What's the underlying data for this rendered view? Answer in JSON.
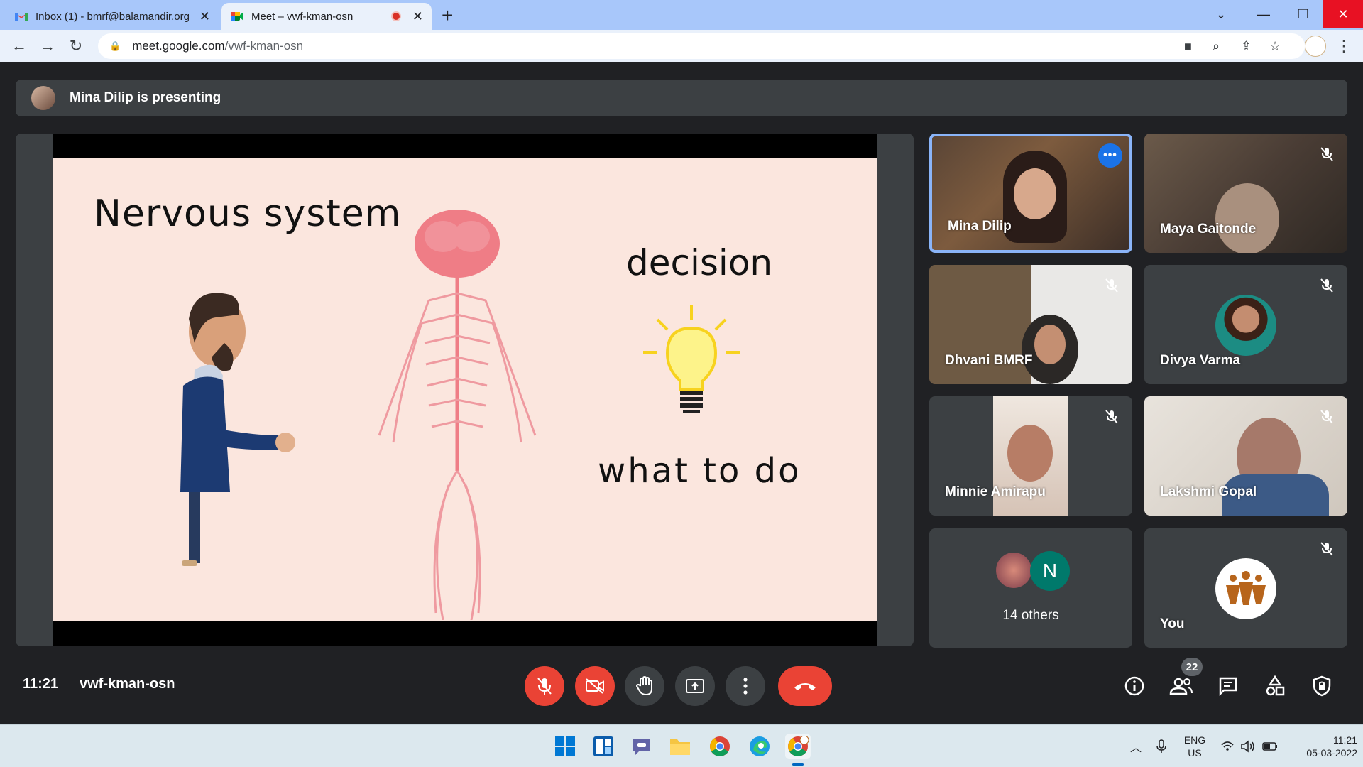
{
  "browser": {
    "tabs": [
      {
        "title": "Inbox (1) - bmrf@balamandir.org",
        "active": false
      },
      {
        "title": "Meet – vwf-kman-osn",
        "active": true
      }
    ],
    "url_host": "meet.google.com",
    "url_path": "/vwf-kman-osn"
  },
  "meet": {
    "presenting_banner": "Mina Dilip is presenting",
    "slide": {
      "title": "Nervous system",
      "word1": "decision",
      "word2": "what to do"
    },
    "participants": [
      {
        "name": "Mina Dilip",
        "speaking": true,
        "muted": false
      },
      {
        "name": "Maya Gaitonde",
        "muted": true
      },
      {
        "name": "Dhvani BMRF",
        "muted": true
      },
      {
        "name": "Divya Varma",
        "muted": true
      },
      {
        "name": "Minnie Amirapu",
        "muted": true
      },
      {
        "name": "Lakshmi Gopal",
        "muted": true
      },
      {
        "name": "14 others",
        "avatar_letter": "N"
      },
      {
        "name": "You",
        "muted": true
      }
    ],
    "clock": "11:21",
    "meeting_code": "vwf-kman-osn",
    "people_count": "22"
  },
  "taskbar": {
    "language": "ENG",
    "region": "US",
    "time": "11:21",
    "date": "05-03-2022"
  },
  "colors": {
    "meet_bg": "#202124",
    "tile_bg": "#3c4043",
    "red": "#ea4335",
    "blue": "#8ab4f8"
  }
}
